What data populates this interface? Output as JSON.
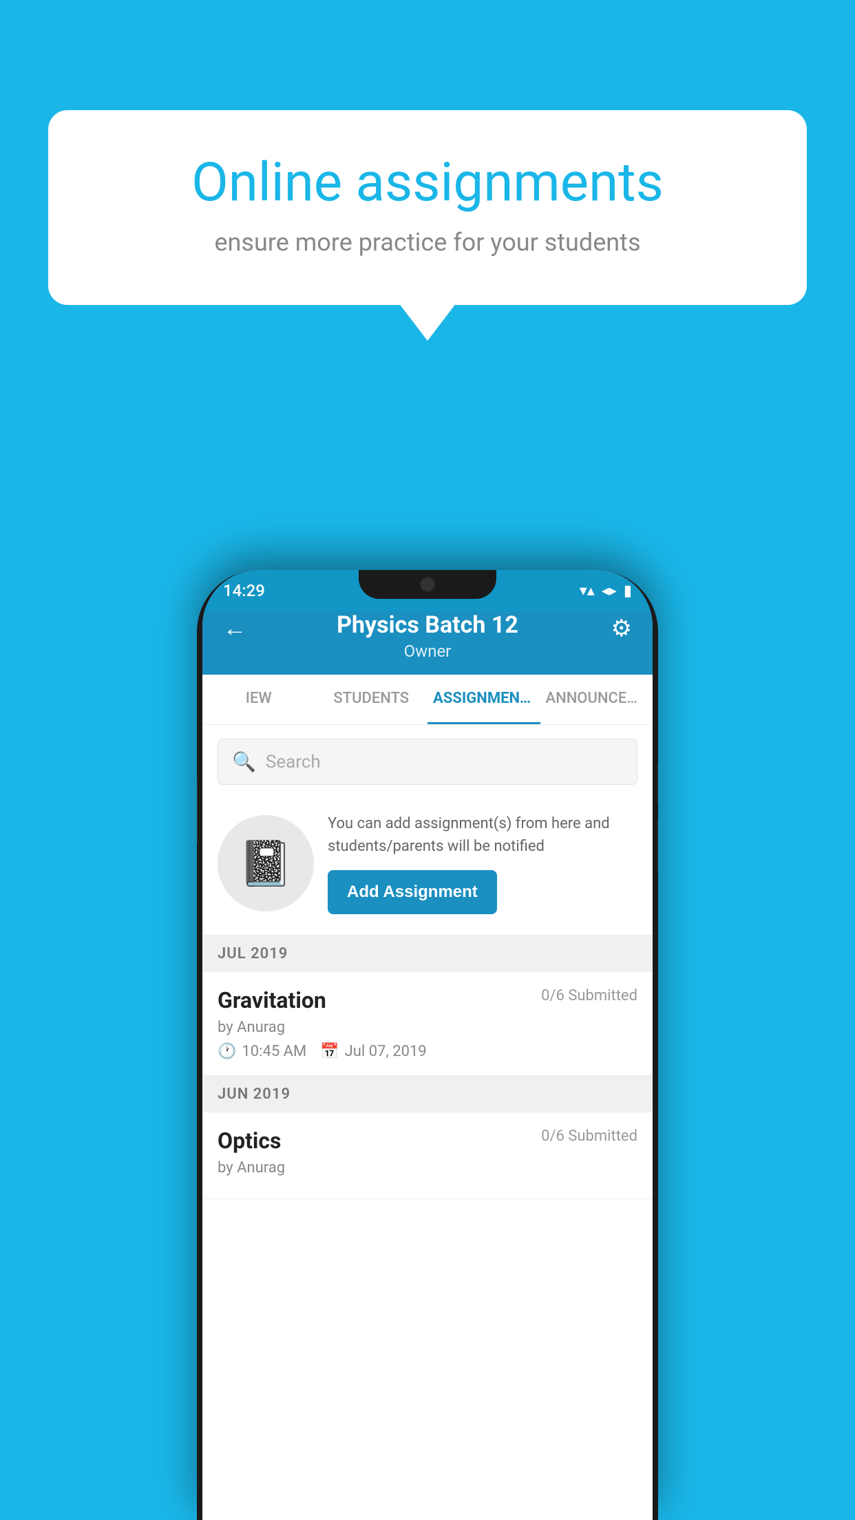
{
  "background_color": "#1ab6e8",
  "speech_bubble": {
    "title": "Online assignments",
    "subtitle": "ensure more practice for your students"
  },
  "status_bar": {
    "time": "14:29",
    "wifi_icon": "▼",
    "signal_icon": "◀",
    "battery_icon": "▮"
  },
  "header": {
    "title": "Physics Batch 12",
    "subtitle": "Owner",
    "back_label": "←",
    "settings_label": "⚙"
  },
  "tabs": [
    {
      "label": "IEW",
      "active": false
    },
    {
      "label": "STUDENTS",
      "active": false
    },
    {
      "label": "ASSIGNMENTS",
      "active": true
    },
    {
      "label": "ANNOUNCEM...",
      "active": false
    }
  ],
  "search": {
    "placeholder": "Search"
  },
  "promo": {
    "text": "You can add assignment(s) from here and students/parents will be notified",
    "button_label": "Add Assignment"
  },
  "sections": [
    {
      "header": "JUL 2019",
      "assignments": [
        {
          "name": "Gravitation",
          "submitted": "0/6 Submitted",
          "author": "by Anurag",
          "time": "10:45 AM",
          "date": "Jul 07, 2019"
        }
      ]
    },
    {
      "header": "JUN 2019",
      "assignments": [
        {
          "name": "Optics",
          "submitted": "0/6 Submitted",
          "author": "by Anurag",
          "time": "",
          "date": ""
        }
      ]
    }
  ]
}
